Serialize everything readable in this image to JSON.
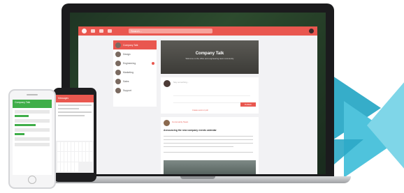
{
  "app": {
    "hero_title": "Company Talk",
    "hero_subtitle": "Welcome to the office and engineering team community",
    "search_placeholder": "Search...",
    "sidebar": [
      {
        "label": "Company Talk",
        "active": true
      },
      {
        "label": "Design",
        "active": false
      },
      {
        "label": "Engineering",
        "active": false
      },
      {
        "label": "Marketing",
        "active": false
      },
      {
        "label": "Sales",
        "active": false
      },
      {
        "label": "Support",
        "active": false
      }
    ],
    "composer": {
      "placeholder": "Say something...",
      "publish_label": "Publish",
      "link_label": "Create event or poll"
    },
    "post": {
      "author": "Community Team",
      "title": "Announcing the new company events calendar"
    }
  },
  "phone_white": {
    "header": "Company Talk"
  },
  "phone_black": {
    "header": "Messages"
  },
  "colors": {
    "accent": "#e9574f",
    "green": "#3fae49",
    "teal": "#2ba9c6"
  }
}
